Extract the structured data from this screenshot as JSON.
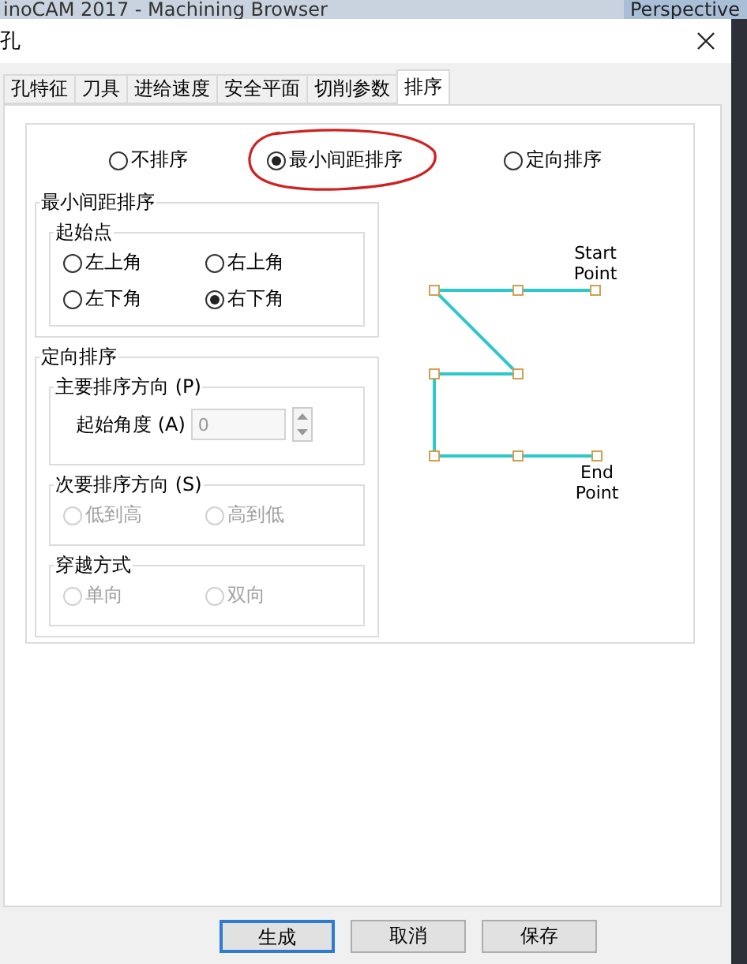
{
  "background_app": {
    "title": "inoCAM 2017 - Machining Browser",
    "view_label": "Perspective"
  },
  "dialog": {
    "title": "孔"
  },
  "tabs": [
    {
      "label": "孔特征",
      "selected": false
    },
    {
      "label": "刀具",
      "selected": false
    },
    {
      "label": "进给速度",
      "selected": false
    },
    {
      "label": "安全平面",
      "selected": false
    },
    {
      "label": "切削参数",
      "selected": false
    },
    {
      "label": "排序",
      "selected": true
    }
  ],
  "sort_modes": [
    {
      "label": "不排序",
      "selected": false,
      "circled": false
    },
    {
      "label": "最小间距排序",
      "selected": true,
      "circled": true
    },
    {
      "label": "定向排序",
      "selected": false,
      "circled": false
    }
  ],
  "min_distance": {
    "title": "最小间距排序",
    "start_point": {
      "title": "起始点",
      "options": [
        {
          "label": "左上角",
          "selected": false
        },
        {
          "label": "右上角",
          "selected": false
        },
        {
          "label": "左下角",
          "selected": false
        },
        {
          "label": "右下角",
          "selected": true
        }
      ]
    }
  },
  "directional": {
    "title": "定向排序",
    "primary": {
      "title": "主要排序方向 (P)",
      "angle_label": "起始角度 (A)",
      "angle_value": "0",
      "disabled": true
    },
    "secondary": {
      "title": "次要排序方向 (S)",
      "options": [
        {
          "label": "低到高",
          "selected": false,
          "disabled": true
        },
        {
          "label": "高到低",
          "selected": false,
          "disabled": true
        }
      ]
    },
    "traverse": {
      "title": "穿越方式",
      "options": [
        {
          "label": "单向",
          "selected": false,
          "disabled": true
        },
        {
          "label": "双向",
          "selected": false,
          "disabled": true
        }
      ]
    }
  },
  "diagram": {
    "start_label": "Start Point",
    "end_label": "End Point"
  },
  "buttons": [
    {
      "label": "生成",
      "default": true
    },
    {
      "label": "取消",
      "default": false
    },
    {
      "label": "保存",
      "default": false
    }
  ]
}
